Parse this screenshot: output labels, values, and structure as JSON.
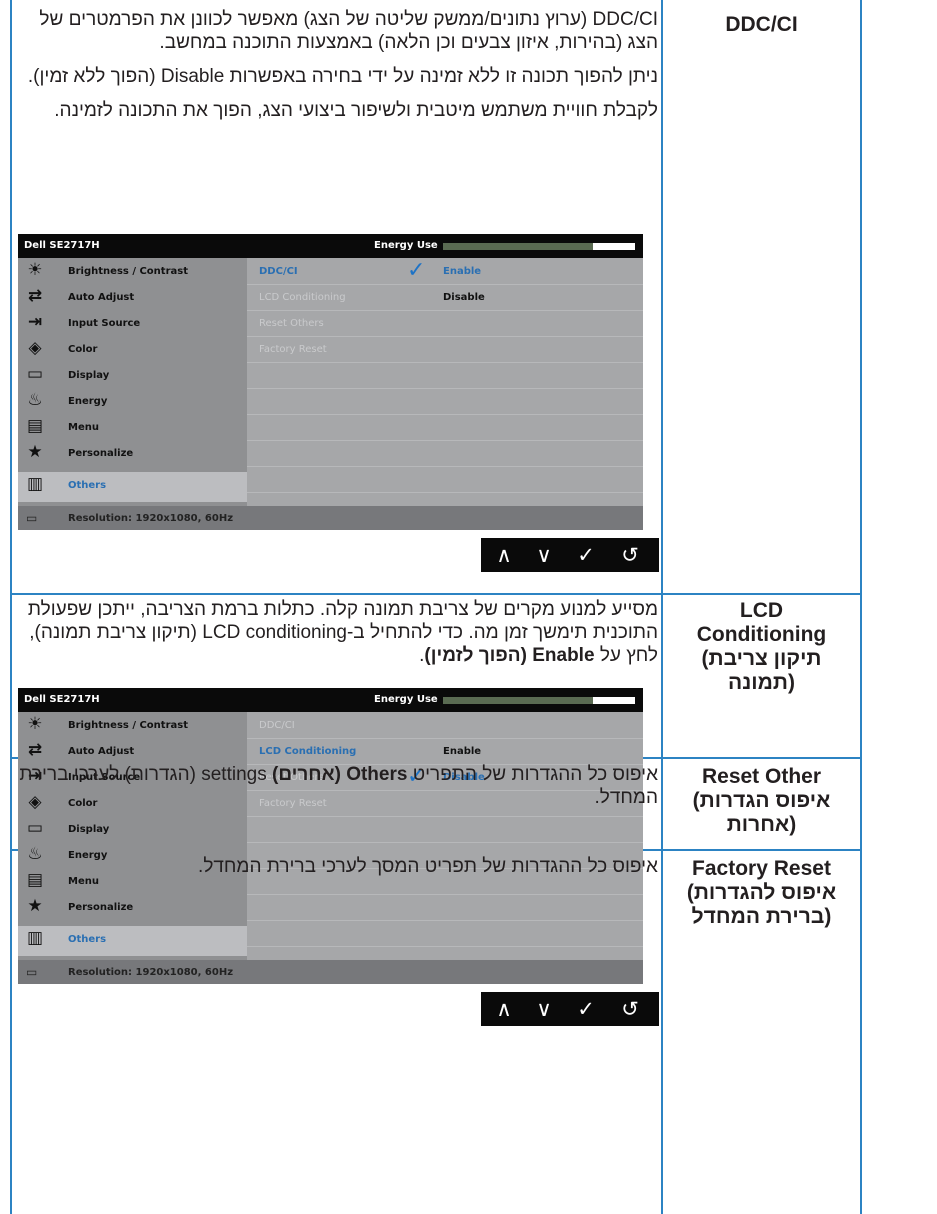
{
  "rows": [
    {
      "title": "DDC/CI",
      "paragraphs": [
        "DDC/CI (ערוץ נתונים/ממשק שליטה של הצג) מאפשר לכוונן את הפרמטרים של הצג (בהירות, איזון צבעים וכן הלאה) באמצעות התוכנה במחשב.",
        "ניתן להפוך תכונה זו ללא זמינה על ידי בחירה באפשרות Disable (הפוך ללא זמין).",
        "לקבלת חוויית משתמש מיטבית ולשיפור ביצועי הצג, הפוך את התכונה לזמינה."
      ]
    },
    {
      "title_lines": [
        "LCD",
        "Conditioning",
        "(תיקון צריבת",
        "תמונה)"
      ],
      "text_a": "מסייע למנוע מקרים של צריבת תמונה קלה. כתלות ברמת הצריבה, ייתכן שפעולת התוכנית תימשך זמן מה. כדי להתחיל ב-LCD conditioning (תיקון צריבת תמונה), לחץ על ",
      "text_b": "Enable (הפוך לזמין)",
      "text_c": "."
    },
    {
      "title_lines": [
        "Reset Other",
        "(איפוס הגדרות",
        "אחרות)"
      ],
      "text_a": "איפוס כל ההגדרות של התפריט ",
      "text_b": "Others (אחרים)",
      "text_c": " settings (הגדרות) לערכי ברירת המחדל."
    },
    {
      "title_lines": [
        "Factory Reset",
        "(איפוס להגדרות",
        "ברירת המחדל)"
      ],
      "text": "איפוס כל ההגדרות של תפריט המסך לערכי ברירת המחדל."
    }
  ],
  "osd": {
    "model": "Dell SE2717H",
    "energy_label": "Energy Use",
    "menu": [
      {
        "icon": "brightness-icon",
        "glyph": "☀",
        "label": "Brightness / Contrast"
      },
      {
        "icon": "auto-adjust-icon",
        "glyph": "⇄",
        "label": "Auto Adjust"
      },
      {
        "icon": "input-source-icon",
        "glyph": "⇥",
        "label": "Input Source"
      },
      {
        "icon": "color-icon",
        "glyph": "◈",
        "label": "Color"
      },
      {
        "icon": "display-icon",
        "glyph": "▭",
        "label": "Display"
      },
      {
        "icon": "energy-icon",
        "glyph": "♨",
        "label": "Energy"
      },
      {
        "icon": "menu-icon",
        "glyph": "▤",
        "label": "Menu"
      },
      {
        "icon": "personalize-icon",
        "glyph": "★",
        "label": "Personalize"
      },
      {
        "icon": "others-icon",
        "glyph": "▥",
        "label": "Others"
      }
    ],
    "submenu": [
      "DDC/CI",
      "LCD Conditioning",
      "Reset Others",
      "Factory Reset"
    ],
    "enable": "Enable",
    "disable": "Disable",
    "status": "Resolution: 1920x1080, 60Hz",
    "nav": [
      {
        "icon": "up-arrow-icon",
        "glyph": "∧"
      },
      {
        "icon": "down-arrow-icon",
        "glyph": "∨"
      },
      {
        "icon": "check-icon",
        "glyph": "✓"
      },
      {
        "icon": "back-icon",
        "glyph": "↺"
      }
    ]
  },
  "colors": {
    "table_border": "#2c83c3",
    "highlight": "#2a6fb2"
  }
}
